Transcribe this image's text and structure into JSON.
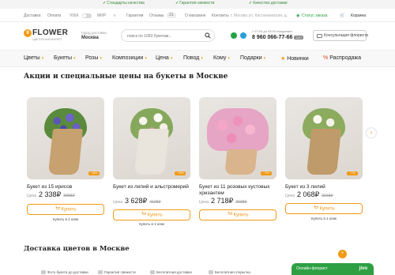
{
  "topbar": {
    "promos": [
      "Стандарты качества",
      "Гарантия свежести",
      "Качество доставки"
    ]
  },
  "util": {
    "delivery": "Доставка",
    "payment": "Оплата",
    "visa": "VISA",
    "mir": "МИР",
    "guarantees": "Гарантии",
    "reviews": "Отзывы",
    "reviews_count": "21",
    "about": "О магазине",
    "contacts": "Контакты",
    "address": "г. Москва ул. Кастанаевская, д.",
    "order_status": "Статус заказа",
    "cart": "Корзина"
  },
  "header": {
    "logo_letter": "9",
    "logo": "FLOWER",
    "logo_sub": "ЦВЕТОЧНЫЙ МАРКЕТ",
    "city_label": "город доставки",
    "city": "Москва",
    "search_placeholder": "поиск по 1093 букетам...",
    "hours": "с 07:00 до 03:00 ежедневно",
    "phone": "8 960 066-77-66",
    "phone_hint": "24/7",
    "consult": "Консультация флориста"
  },
  "nav": {
    "items": [
      "Цветы",
      "Букеты",
      "Розы",
      "Композиции",
      "Цена",
      "Повод",
      "Кому",
      "Подарки"
    ],
    "news": "Новинки",
    "sale": "Распродажа"
  },
  "promo_section": {
    "title": "Акции и специальные цены на букеты в Москве"
  },
  "products": [
    {
      "title": "Букет из 15 ирисов",
      "price_label": "Цена",
      "price": "2 338₽",
      "old": "3058₽",
      "buy": "Купить",
      "oneclick": "",
      "tag": "−18%"
    },
    {
      "title": "Букет из лилий и альстромерий",
      "price_label": "Цена",
      "price": "3 628₽",
      "old": "4128₽",
      "buy": "Купить",
      "oneclick": "Купить в 1 клик",
      "tag": "−12%"
    },
    {
      "title": "Букет из 11 розовых кустовых хризантем",
      "price_label": "Цена",
      "price": "2 718₽",
      "old": "2938₽",
      "buy": "Купить",
      "oneclick": "",
      "tag": "−7%"
    },
    {
      "title": "Букет из 3 лилий",
      "price_label": "Цена",
      "price": "2 068₽",
      "old": "2218₽",
      "buy": "Купить",
      "oneclick": "Купить в 1 клик",
      "tag": "−7%"
    }
  ],
  "first_oneclick": "Купить в 1 клик",
  "delivery_section": {
    "title": "Доставка цветов в Москве"
  },
  "footer_strip": [
    "Фото букета до доставки",
    "Гарантия свежести",
    "Бесплатная доставка",
    "Бесплатная открытка"
  ],
  "chat": {
    "label": "Онлайн-флорист",
    "brand": "jivo"
  },
  "colors": {
    "accent": "#f29a16",
    "green": "#2ea043"
  }
}
